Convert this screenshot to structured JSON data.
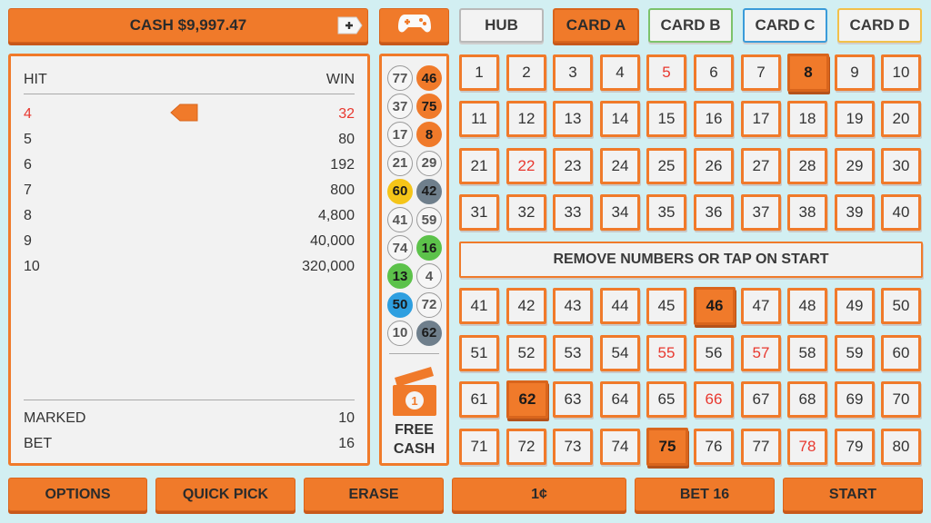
{
  "header": {
    "cash_label": "CASH $9,997.47",
    "add_icon": "plus-icon",
    "game_icon": "gamepad-icon"
  },
  "tabs": [
    {
      "label": "HUB",
      "active": false,
      "border": "#b9b9b9"
    },
    {
      "label": "CARD A",
      "active": true,
      "border": "#d9651c"
    },
    {
      "label": "CARD B",
      "active": false,
      "border": "#7cc36b"
    },
    {
      "label": "CARD C",
      "active": false,
      "border": "#3a9bd9"
    },
    {
      "label": "CARD D",
      "active": false,
      "border": "#f2c14a"
    }
  ],
  "paytable": {
    "hit_header": "HIT",
    "win_header": "WIN",
    "rows": [
      {
        "hit": "4",
        "win": "32",
        "highlight": true
      },
      {
        "hit": "5",
        "win": "80",
        "highlight": false
      },
      {
        "hit": "6",
        "win": "192",
        "highlight": false
      },
      {
        "hit": "7",
        "win": "800",
        "highlight": false
      },
      {
        "hit": "8",
        "win": "4,800",
        "highlight": false
      },
      {
        "hit": "9",
        "win": "40,000",
        "highlight": false
      },
      {
        "hit": "10",
        "win": "320,000",
        "highlight": false
      }
    ],
    "marked_label": "MARKED",
    "marked_value": "10",
    "bet_label": "BET",
    "bet_value": "16"
  },
  "drawn_balls": [
    {
      "n": "77",
      "color": "plain"
    },
    {
      "n": "46",
      "color": "orange"
    },
    {
      "n": "37",
      "color": "plain"
    },
    {
      "n": "75",
      "color": "orange"
    },
    {
      "n": "17",
      "color": "plain"
    },
    {
      "n": "8",
      "color": "orange"
    },
    {
      "n": "21",
      "color": "plain"
    },
    {
      "n": "29",
      "color": "plain"
    },
    {
      "n": "60",
      "color": "yellow"
    },
    {
      "n": "42",
      "color": "gray"
    },
    {
      "n": "41",
      "color": "plain"
    },
    {
      "n": "59",
      "color": "plain"
    },
    {
      "n": "74",
      "color": "plain"
    },
    {
      "n": "16",
      "color": "green"
    },
    {
      "n": "13",
      "color": "green"
    },
    {
      "n": "4",
      "color": "plain"
    },
    {
      "n": "50",
      "color": "blue"
    },
    {
      "n": "72",
      "color": "plain"
    },
    {
      "n": "10",
      "color": "plain"
    },
    {
      "n": "62",
      "color": "gray"
    }
  ],
  "ball_colors": {
    "plain": "#f6f6f6",
    "orange": "#f07a2a",
    "yellow": "#f5c518",
    "gray": "#6f7f8c",
    "green": "#5cc24a",
    "blue": "#2e9fe0"
  },
  "free_cash": {
    "label": "FREE CASH",
    "badge": "1",
    "icon": "ticket-icon"
  },
  "board": {
    "selected": [
      8,
      46,
      62,
      75
    ],
    "red": [
      5,
      22,
      55,
      57,
      66,
      78
    ],
    "message": "REMOVE NUMBERS OR TAP ON START"
  },
  "footer": [
    {
      "name": "options-button",
      "label": "OPTIONS"
    },
    {
      "name": "quick-pick-button",
      "label": "QUICK PICK"
    },
    {
      "name": "erase-button",
      "label": "ERASE"
    },
    {
      "name": "denomination-button",
      "label": "1¢"
    },
    {
      "name": "bet-button",
      "label": "BET 16"
    },
    {
      "name": "start-button",
      "label": "START"
    }
  ]
}
